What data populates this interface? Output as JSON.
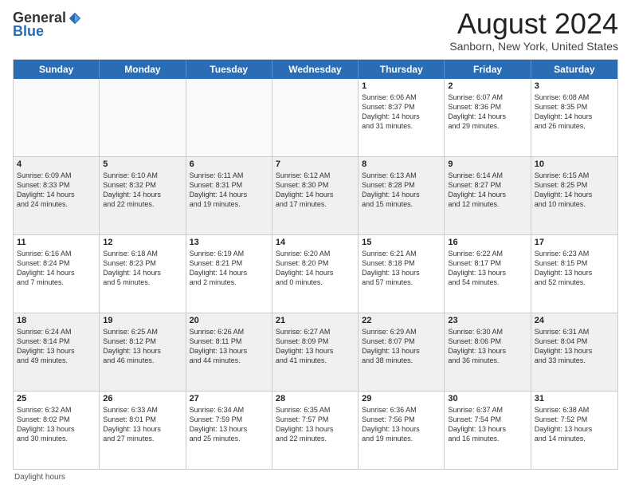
{
  "logo": {
    "general": "General",
    "blue": "Blue"
  },
  "title": {
    "month": "August 2024",
    "location": "Sanborn, New York, United States"
  },
  "weekdays": [
    "Sunday",
    "Monday",
    "Tuesday",
    "Wednesday",
    "Thursday",
    "Friday",
    "Saturday"
  ],
  "footer": {
    "note": "Daylight hours"
  },
  "weeks": [
    [
      {
        "day": "",
        "info": ""
      },
      {
        "day": "",
        "info": ""
      },
      {
        "day": "",
        "info": ""
      },
      {
        "day": "",
        "info": ""
      },
      {
        "day": "1",
        "info": "Sunrise: 6:06 AM\nSunset: 8:37 PM\nDaylight: 14 hours\nand 31 minutes."
      },
      {
        "day": "2",
        "info": "Sunrise: 6:07 AM\nSunset: 8:36 PM\nDaylight: 14 hours\nand 29 minutes."
      },
      {
        "day": "3",
        "info": "Sunrise: 6:08 AM\nSunset: 8:35 PM\nDaylight: 14 hours\nand 26 minutes."
      }
    ],
    [
      {
        "day": "4",
        "info": "Sunrise: 6:09 AM\nSunset: 8:33 PM\nDaylight: 14 hours\nand 24 minutes."
      },
      {
        "day": "5",
        "info": "Sunrise: 6:10 AM\nSunset: 8:32 PM\nDaylight: 14 hours\nand 22 minutes."
      },
      {
        "day": "6",
        "info": "Sunrise: 6:11 AM\nSunset: 8:31 PM\nDaylight: 14 hours\nand 19 minutes."
      },
      {
        "day": "7",
        "info": "Sunrise: 6:12 AM\nSunset: 8:30 PM\nDaylight: 14 hours\nand 17 minutes."
      },
      {
        "day": "8",
        "info": "Sunrise: 6:13 AM\nSunset: 8:28 PM\nDaylight: 14 hours\nand 15 minutes."
      },
      {
        "day": "9",
        "info": "Sunrise: 6:14 AM\nSunset: 8:27 PM\nDaylight: 14 hours\nand 12 minutes."
      },
      {
        "day": "10",
        "info": "Sunrise: 6:15 AM\nSunset: 8:25 PM\nDaylight: 14 hours\nand 10 minutes."
      }
    ],
    [
      {
        "day": "11",
        "info": "Sunrise: 6:16 AM\nSunset: 8:24 PM\nDaylight: 14 hours\nand 7 minutes."
      },
      {
        "day": "12",
        "info": "Sunrise: 6:18 AM\nSunset: 8:23 PM\nDaylight: 14 hours\nand 5 minutes."
      },
      {
        "day": "13",
        "info": "Sunrise: 6:19 AM\nSunset: 8:21 PM\nDaylight: 14 hours\nand 2 minutes."
      },
      {
        "day": "14",
        "info": "Sunrise: 6:20 AM\nSunset: 8:20 PM\nDaylight: 14 hours\nand 0 minutes."
      },
      {
        "day": "15",
        "info": "Sunrise: 6:21 AM\nSunset: 8:18 PM\nDaylight: 13 hours\nand 57 minutes."
      },
      {
        "day": "16",
        "info": "Sunrise: 6:22 AM\nSunset: 8:17 PM\nDaylight: 13 hours\nand 54 minutes."
      },
      {
        "day": "17",
        "info": "Sunrise: 6:23 AM\nSunset: 8:15 PM\nDaylight: 13 hours\nand 52 minutes."
      }
    ],
    [
      {
        "day": "18",
        "info": "Sunrise: 6:24 AM\nSunset: 8:14 PM\nDaylight: 13 hours\nand 49 minutes."
      },
      {
        "day": "19",
        "info": "Sunrise: 6:25 AM\nSunset: 8:12 PM\nDaylight: 13 hours\nand 46 minutes."
      },
      {
        "day": "20",
        "info": "Sunrise: 6:26 AM\nSunset: 8:11 PM\nDaylight: 13 hours\nand 44 minutes."
      },
      {
        "day": "21",
        "info": "Sunrise: 6:27 AM\nSunset: 8:09 PM\nDaylight: 13 hours\nand 41 minutes."
      },
      {
        "day": "22",
        "info": "Sunrise: 6:29 AM\nSunset: 8:07 PM\nDaylight: 13 hours\nand 38 minutes."
      },
      {
        "day": "23",
        "info": "Sunrise: 6:30 AM\nSunset: 8:06 PM\nDaylight: 13 hours\nand 36 minutes."
      },
      {
        "day": "24",
        "info": "Sunrise: 6:31 AM\nSunset: 8:04 PM\nDaylight: 13 hours\nand 33 minutes."
      }
    ],
    [
      {
        "day": "25",
        "info": "Sunrise: 6:32 AM\nSunset: 8:02 PM\nDaylight: 13 hours\nand 30 minutes."
      },
      {
        "day": "26",
        "info": "Sunrise: 6:33 AM\nSunset: 8:01 PM\nDaylight: 13 hours\nand 27 minutes."
      },
      {
        "day": "27",
        "info": "Sunrise: 6:34 AM\nSunset: 7:59 PM\nDaylight: 13 hours\nand 25 minutes."
      },
      {
        "day": "28",
        "info": "Sunrise: 6:35 AM\nSunset: 7:57 PM\nDaylight: 13 hours\nand 22 minutes."
      },
      {
        "day": "29",
        "info": "Sunrise: 6:36 AM\nSunset: 7:56 PM\nDaylight: 13 hours\nand 19 minutes."
      },
      {
        "day": "30",
        "info": "Sunrise: 6:37 AM\nSunset: 7:54 PM\nDaylight: 13 hours\nand 16 minutes."
      },
      {
        "day": "31",
        "info": "Sunrise: 6:38 AM\nSunset: 7:52 PM\nDaylight: 13 hours\nand 14 minutes."
      }
    ]
  ]
}
